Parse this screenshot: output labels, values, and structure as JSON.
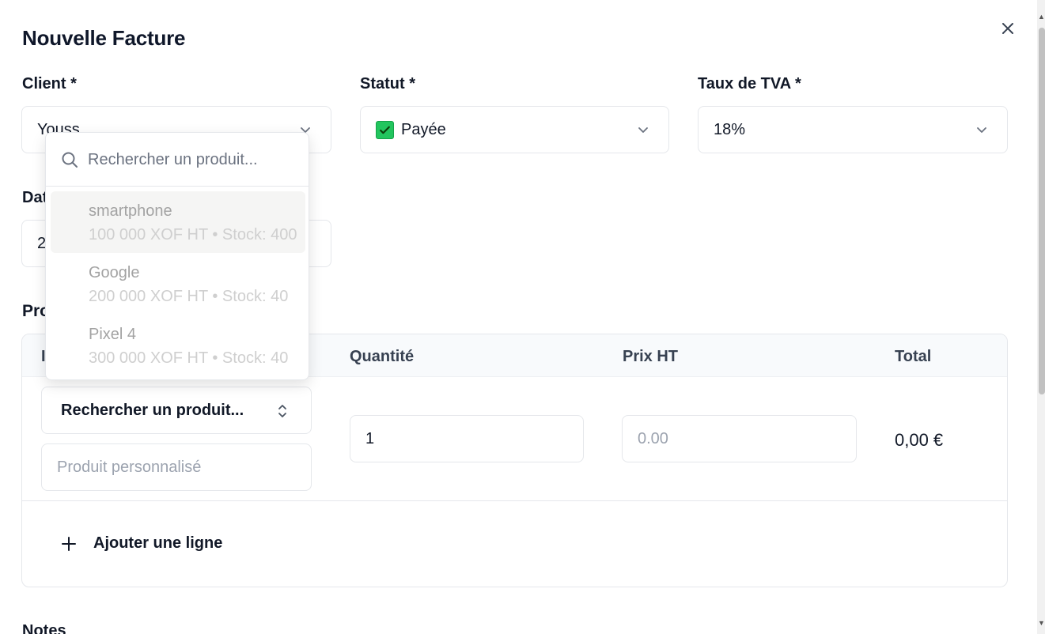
{
  "dialog": {
    "title": "Nouvelle Facture"
  },
  "fields": {
    "client_label": "Client *",
    "client_value": "Youss",
    "status_label": "Statut *",
    "status_value": "Payée",
    "vat_label": "Taux de TVA *",
    "vat_value": "18%",
    "date_label": "Dat",
    "date_value": "2"
  },
  "products": {
    "section_label": "Pro",
    "headers": {
      "product": "I",
      "quantity": "Quantité",
      "price": "Prix HT",
      "total": "Total"
    },
    "row": {
      "search_combo": "Rechercher un produit...",
      "custom_placeholder": "Produit personnalisé",
      "quantity": "1",
      "price_placeholder": "0.00",
      "total": "0,00 €"
    },
    "add_line": "Ajouter une ligne"
  },
  "notes_label": "Notes",
  "dropdown": {
    "search_placeholder": "Rechercher un produit...",
    "items": [
      {
        "name": "smartphone",
        "detail": "100 000 XOF HT • Stock: 400"
      },
      {
        "name": "Google",
        "detail": "200 000 XOF HT • Stock: 40"
      },
      {
        "name": "Pixel 4",
        "detail": "300 000 XOF HT • Stock: 40"
      }
    ]
  },
  "icons": {
    "close": "close-icon",
    "chevron": "chevron-down-icon",
    "status_check": "check-box-icon",
    "search": "search-icon",
    "updown": "chevron-up-down-icon",
    "plus": "plus-icon"
  },
  "colors": {
    "status_check_green": "#22c55e",
    "border": "#e5e7eb",
    "table_header_bg": "#f8fafc"
  }
}
